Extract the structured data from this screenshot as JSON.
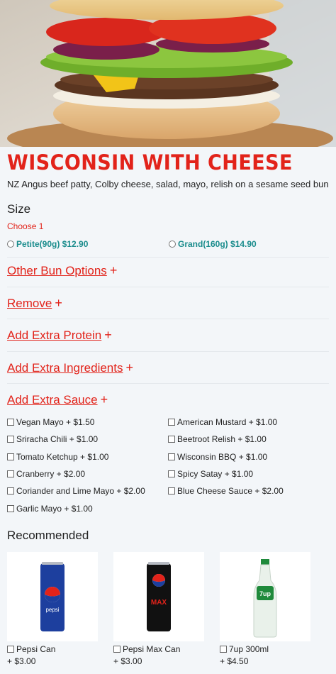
{
  "product": {
    "title": "WISCONSIN WITH CHEESE",
    "description": "NZ Angus beef patty, Colby cheese, salad, mayo, relish on a sesame seed bun"
  },
  "size": {
    "heading": "Size",
    "choose": "Choose 1",
    "options": [
      "Petite(90g) $12.90",
      "Grand(160g) $14.90"
    ]
  },
  "sections": {
    "bun": "Other Bun Options",
    "remove": "Remove",
    "protein": "Add Extra Protein",
    "ingredients": "Add Extra Ingredients",
    "sauce": "Add Extra Sauce",
    "plus": "+"
  },
  "sauces_left": [
    "Vegan Mayo + $1.50",
    "Sriracha Chili + $1.00",
    "Tomato Ketchup + $1.00",
    "Cranberry + $2.00",
    "Coriander and Lime Mayo + $2.00",
    "Garlic Mayo + $1.00"
  ],
  "sauces_right": [
    "American Mustard + $1.00",
    "Beetroot Relish + $1.00",
    "Wisconsin BBQ + $1.00",
    "Spicy Satay + $1.00",
    "Blue Cheese Sauce + $2.00"
  ],
  "recommended": {
    "heading": "Recommended",
    "items": [
      {
        "name": "Pepsi Can",
        "price": "+ $3.00",
        "can_text": "pepsi"
      },
      {
        "name": "Pepsi Max Can",
        "price": "+ $3.00",
        "can_text": "MAX"
      },
      {
        "name": "7up 300ml",
        "price": "+ $4.50",
        "can_text": "7up"
      }
    ]
  },
  "colors": {
    "accent": "#e2231a",
    "option": "#1a8c8c",
    "background": "#f3f6f9"
  }
}
